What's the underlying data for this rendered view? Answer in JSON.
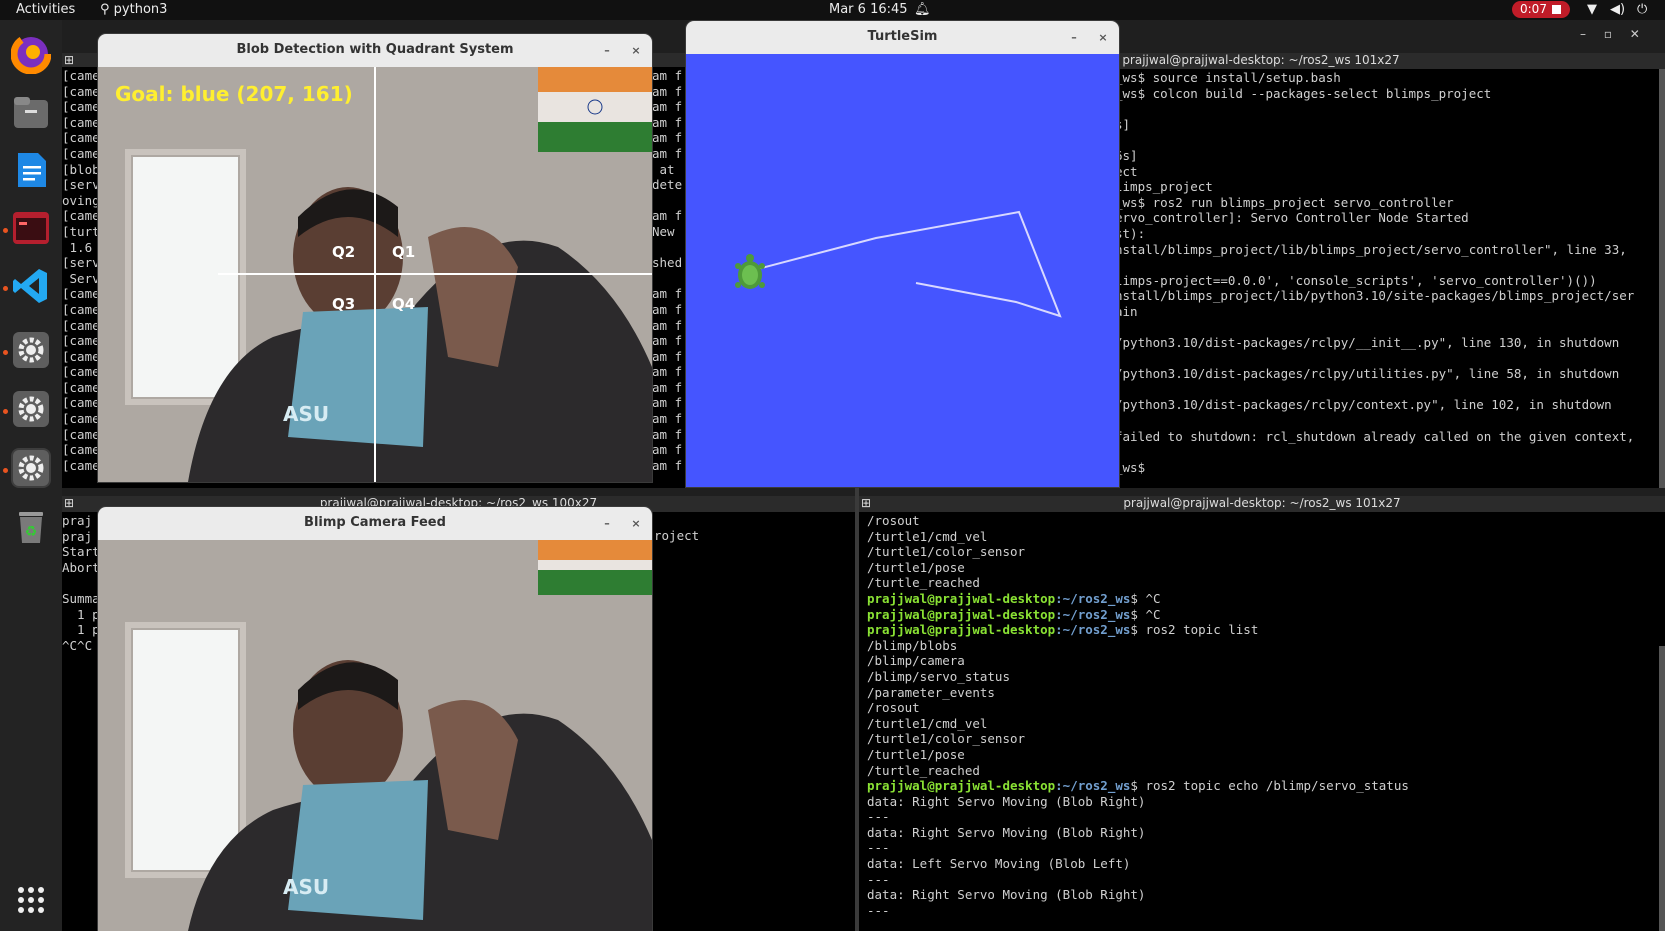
{
  "topbar": {
    "activities": "Activities",
    "app_name": "python3",
    "clock": "Mar 6  16:45",
    "recording_time": "0:07"
  },
  "dock": {
    "items": [
      "firefox-icon",
      "files-icon",
      "writer-icon",
      "terminal-icon",
      "vscode-icon",
      "settings-icon",
      "settings-icon",
      "settings-icon",
      "trash-icon",
      "app-grid-icon"
    ]
  },
  "term_top_left": {
    "lines": [
      "[came",
      "[came",
      "[came",
      "[came",
      "[came",
      "[came",
      "[blob",
      "[serv",
      "oving",
      "[came",
      "[turt",
      " 1.6",
      "[serv",
      " Serv",
      "[came",
      "[came",
      "[came",
      "[came",
      "[came",
      "[came",
      "[came",
      "[came",
      "[came",
      "[came",
      "[came",
      "[came"
    ],
    "right_fragments": [
      "am f",
      "am f",
      "am f",
      "am f",
      "am f",
      "am f",
      " at ",
      "dete",
      "",
      "am f",
      "New ",
      "",
      "shed",
      "",
      "am f",
      "am f",
      "am f",
      "am f",
      "am f",
      "am f",
      "am f",
      "am f",
      "am f",
      "am f",
      "am f",
      "am f"
    ]
  },
  "term_top_right": {
    "title": "prajjwal@prajjwal-desktop: ~/ros2_ws 101x27",
    "lines": [
      "_ws$ source install/setup.bash",
      "_ws$ colcon build --packages-select blimps_project",
      "",
      "s]",
      "",
      "6s]",
      "ect",
      "limps_project",
      "_ws$ ros2 run blimps_project servo_controller",
      "ervo_controller]: Servo Controller Node Started",
      "st):",
      "nstall/blimps_project/lib/blimps_project/servo_controller\", line 33,",
      "",
      "limps-project==0.0.0', 'console_scripts', 'servo_controller')())",
      "nstall/blimps_project/lib/python3.10/site-packages/blimps_project/ser",
      "ain",
      "",
      "/python3.10/dist-packages/rclpy/__init__.py\", line 130, in shutdown",
      "",
      "/python3.10/dist-packages/rclpy/utilities.py\", line 58, in shutdown",
      "",
      "/python3.10/dist-packages/rclpy/context.py\", line 102, in shutdown",
      "",
      "failed to shutdown: rcl_shutdown already called on the given context,",
      "",
      "_ws$ "
    ]
  },
  "term_bottom_left": {
    "title": "prajjwal@prajjwal-desktop: ~/ros2_ws 100x27",
    "lines": [
      "praj",
      "praj",
      "Start",
      "Abort",
      "",
      "Summa",
      "  1 p",
      "  1 p",
      "^C^C"
    ],
    "fragment": "roject"
  },
  "term_bottom_right": {
    "title": "prajjwal@prajjwal-desktop: ~/ros2_ws 101x27",
    "prompt_user": "prajjwal@prajjwal-desktop",
    "prompt_path": ":~/ros2_ws",
    "lines": [
      {
        "t": "out",
        "v": "/rosout"
      },
      {
        "t": "out",
        "v": "/turtle1/cmd_vel"
      },
      {
        "t": "out",
        "v": "/turtle1/color_sensor"
      },
      {
        "t": "out",
        "v": "/turtle1/pose"
      },
      {
        "t": "out",
        "v": "/turtle_reached"
      },
      {
        "t": "cmd",
        "v": "$ ^C"
      },
      {
        "t": "cmd",
        "v": "$ ^C"
      },
      {
        "t": "cmd",
        "v": "$ ros2 topic list"
      },
      {
        "t": "out",
        "v": "/blimp/blobs"
      },
      {
        "t": "out",
        "v": "/blimp/camera"
      },
      {
        "t": "out",
        "v": "/blimp/servo_status"
      },
      {
        "t": "out",
        "v": "/parameter_events"
      },
      {
        "t": "out",
        "v": "/rosout"
      },
      {
        "t": "out",
        "v": "/turtle1/cmd_vel"
      },
      {
        "t": "out",
        "v": "/turtle1/color_sensor"
      },
      {
        "t": "out",
        "v": "/turtle1/pose"
      },
      {
        "t": "out",
        "v": "/turtle_reached"
      },
      {
        "t": "cmd",
        "v": "$ ros2 topic echo /blimp/servo_status"
      },
      {
        "t": "out",
        "v": "data: Right Servo Moving (Blob Right)"
      },
      {
        "t": "out",
        "v": "---"
      },
      {
        "t": "out",
        "v": "data: Right Servo Moving (Blob Right)"
      },
      {
        "t": "out",
        "v": "---"
      },
      {
        "t": "out",
        "v": "data: Left Servo Moving (Blob Left)"
      },
      {
        "t": "out",
        "v": "---"
      },
      {
        "t": "out",
        "v": "data: Right Servo Moving (Blob Right)"
      },
      {
        "t": "out",
        "v": "---"
      }
    ]
  },
  "blob_window": {
    "title": "Blob Detection with Quadrant System",
    "goal_text": "Goal: blue (207, 161)",
    "quadrants": [
      "Q2",
      "Q1",
      "Q3",
      "Q4"
    ],
    "card_text": "ASU"
  },
  "turtlesim": {
    "title": "TurtleSim",
    "background": "#4555ff"
  },
  "camera_window": {
    "title": "Blimp Camera Feed",
    "card_text": "ASU"
  },
  "window_controls": {
    "minimize": "–",
    "close": "×"
  }
}
